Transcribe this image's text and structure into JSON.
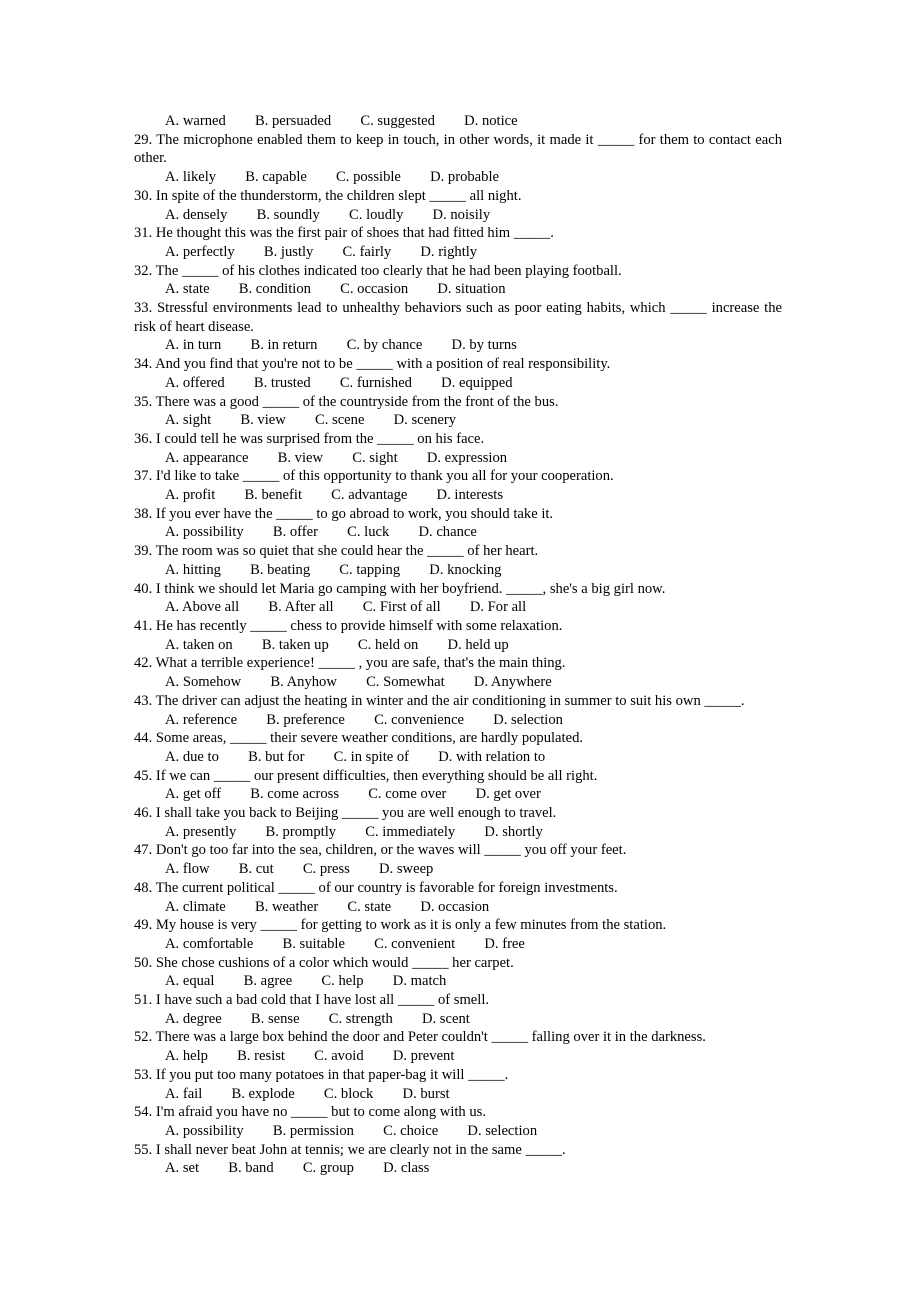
{
  "document": {
    "type": "multiple-choice-grammar-exercise",
    "page_background": "#ffffff",
    "text_color": "#000000",
    "orphan_option_line": "A. warned        B. persuaded        C. suggested        D. notice",
    "questions": [
      {
        "number": "29",
        "stem": "29. The microphone enabled them to keep in touch, in other words, it made it _____ for them to contact each other.",
        "wraps": true,
        "options": "A. likely        B. capable        C. possible        D. probable"
      },
      {
        "number": "30",
        "stem": "30. In spite of the thunderstorm, the children slept _____ all night.",
        "wraps": false,
        "options": "A. densely        B. soundly        C. loudly        D. noisily"
      },
      {
        "number": "31",
        "stem": "31. He thought this was the first pair of shoes that had fitted him _____.",
        "wraps": false,
        "options": "A. perfectly        B. justly        C. fairly        D. rightly"
      },
      {
        "number": "32",
        "stem": "32. The _____ of his clothes indicated too clearly that he had been playing football.",
        "wraps": false,
        "options": "A. state        B. condition        C. occasion        D. situation"
      },
      {
        "number": "33",
        "stem": "33. Stressful environments lead to unhealthy behaviors such as poor eating habits, which _____ increase the risk of heart disease.",
        "wraps": true,
        "options": "A. in turn        B. in return        C. by chance        D. by turns"
      },
      {
        "number": "34",
        "stem": "34. And you find that you're not to be _____ with a position of real responsibility.",
        "wraps": false,
        "options": "A. offered        B. trusted        C. furnished        D. equipped"
      },
      {
        "number": "35",
        "stem": "35. There was a good _____ of the countryside from the front of the bus.",
        "wraps": false,
        "options": "A. sight        B. view        C. scene        D. scenery"
      },
      {
        "number": "36",
        "stem": "36. I could tell he was surprised from the _____ on his face.",
        "wraps": false,
        "options": "A. appearance        B. view        C. sight        D. expression"
      },
      {
        "number": "37",
        "stem": "37. I'd like to take _____ of this opportunity to thank you all for your cooperation.",
        "wraps": false,
        "options": "A. profit        B. benefit        C. advantage        D. interests"
      },
      {
        "number": "38",
        "stem": "38. If you ever have the _____ to go abroad to work, you should take it.",
        "wraps": false,
        "options": "A. possibility        B. offer        C. luck        D. chance"
      },
      {
        "number": "39",
        "stem": "39. The room was so quiet that she could hear the _____ of her heart.",
        "wraps": false,
        "options": "A. hitting        B. beating        C. tapping        D. knocking"
      },
      {
        "number": "40",
        "stem": "40. I think we should let Maria go camping with her boyfriend. _____, she's a big girl now.",
        "wraps": false,
        "options": "A. Above all        B. After all        C. First of all        D. For all"
      },
      {
        "number": "41",
        "stem": "41. He has recently _____ chess to provide himself with some relaxation.",
        "wraps": false,
        "options": "A. taken on        B. taken up        C. held on        D. held up"
      },
      {
        "number": "42",
        "stem": "42. What a terrible experience! _____ , you are safe, that's the main thing.",
        "wraps": false,
        "options": "A. Somehow        B. Anyhow        C. Somewhat        D. Anywhere"
      },
      {
        "number": "43",
        "stem": "43. The driver can adjust the heating in winter and the air conditioning in summer to suit his own _____.",
        "wraps": true,
        "options": "A. reference        B. preference        C. convenience        D. selection"
      },
      {
        "number": "44",
        "stem": "44. Some areas, _____ their severe weather conditions, are hardly populated.",
        "wraps": false,
        "options": "A. due to        B. but for        C. in spite of        D. with relation to"
      },
      {
        "number": "45",
        "stem": "45. If we can _____ our present difficulties, then everything should be all right.",
        "wraps": false,
        "options": "A. get off        B. come across        C. come over        D. get over"
      },
      {
        "number": "46",
        "stem": "46. I shall take you back to Beijing _____ you are well enough to travel.",
        "wraps": false,
        "options": "A. presently        B. promptly        C. immediately        D. shortly"
      },
      {
        "number": "47",
        "stem": "47. Don't go too far into the sea, children, or the waves will _____ you off your feet.",
        "wraps": false,
        "options": "A. flow        B. cut        C. press        D. sweep"
      },
      {
        "number": "48",
        "stem": "48. The current political _____ of our country is favorable for foreign investments.",
        "wraps": false,
        "options": "A. climate        B. weather        C. state        D. occasion"
      },
      {
        "number": "49",
        "stem": "49. My house is very _____ for getting to work as it is only a few minutes from the station.",
        "wraps": false,
        "options": "A. comfortable        B. suitable        C. convenient        D. free"
      },
      {
        "number": "50",
        "stem": "50. She chose cushions of a color which would _____ her carpet.",
        "wraps": false,
        "options": "A. equal        B. agree        C. help        D. match"
      },
      {
        "number": "51",
        "stem": "51. I have such a bad cold that I have lost all _____ of smell.",
        "wraps": false,
        "options": "A. degree        B. sense        C. strength        D. scent"
      },
      {
        "number": "52",
        "stem": "52. There was a large box behind the door and Peter couldn't _____ falling over it in the darkness.",
        "wraps": false,
        "options": "A. help        B. resist        C. avoid        D. prevent"
      },
      {
        "number": "53",
        "stem": "53. If you put too many potatoes in that paper-bag it will _____.",
        "wraps": false,
        "options": "A. fail        B. explode        C. block        D. burst"
      },
      {
        "number": "54",
        "stem": "54. I'm afraid you have no _____ but to come along with us.",
        "wraps": false,
        "options": "A. possibility        B. permission        C. choice        D. selection"
      },
      {
        "number": "55",
        "stem": "55. I shall never beat John at tennis; we are clearly not in the same _____.",
        "wraps": false,
        "options": "A. set        B. band        C. group        D. class"
      }
    ]
  }
}
